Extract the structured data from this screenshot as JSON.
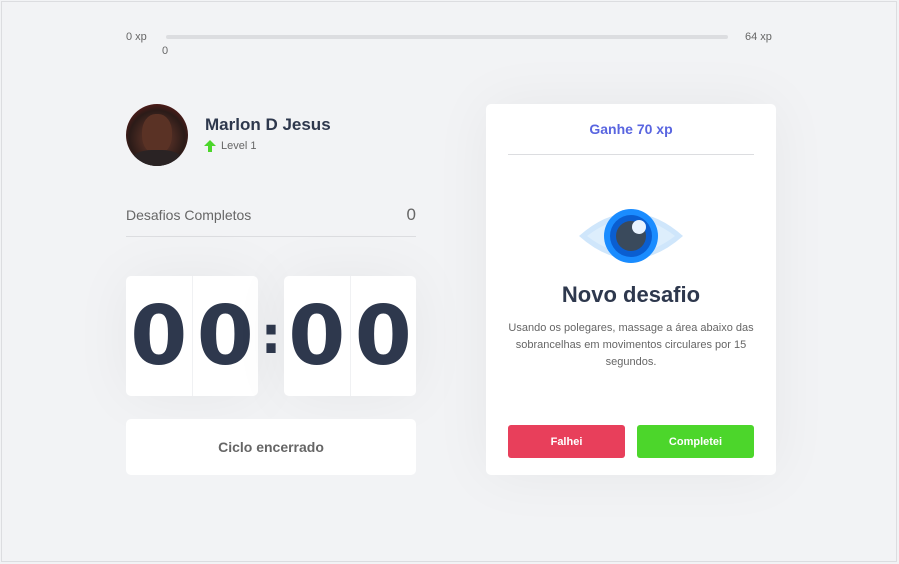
{
  "xp_bar": {
    "min_label": "0 xp",
    "max_label": "64 xp",
    "current_label": "0",
    "progress_percent": 0
  },
  "profile": {
    "name": "Marlon D Jesus",
    "level_label": "Level 1",
    "level_icon": "level-up-arrow-icon"
  },
  "completed_challenges": {
    "label": "Desafios Completos",
    "count": "0"
  },
  "countdown": {
    "minute_left": "0",
    "minute_right": "0",
    "separator": ":",
    "second_left": "0",
    "second_right": "0"
  },
  "cycle_button": {
    "label": "Ciclo encerrado"
  },
  "challenge_card": {
    "header": "Ganhe 70 xp",
    "icon": "eye-icon",
    "title": "Novo desafio",
    "description": "Usando os polegares, massage a área abaixo das sobrancelhas em movimentos circulares por 15 segundos.",
    "failed_label": "Falhei",
    "completed_label": "Completei"
  },
  "colors": {
    "background": "#f2f3f5",
    "text": "#2e384d",
    "accent_blue": "#5965e0",
    "success_green": "#4cd62b",
    "failure_red": "#e83f5b"
  }
}
